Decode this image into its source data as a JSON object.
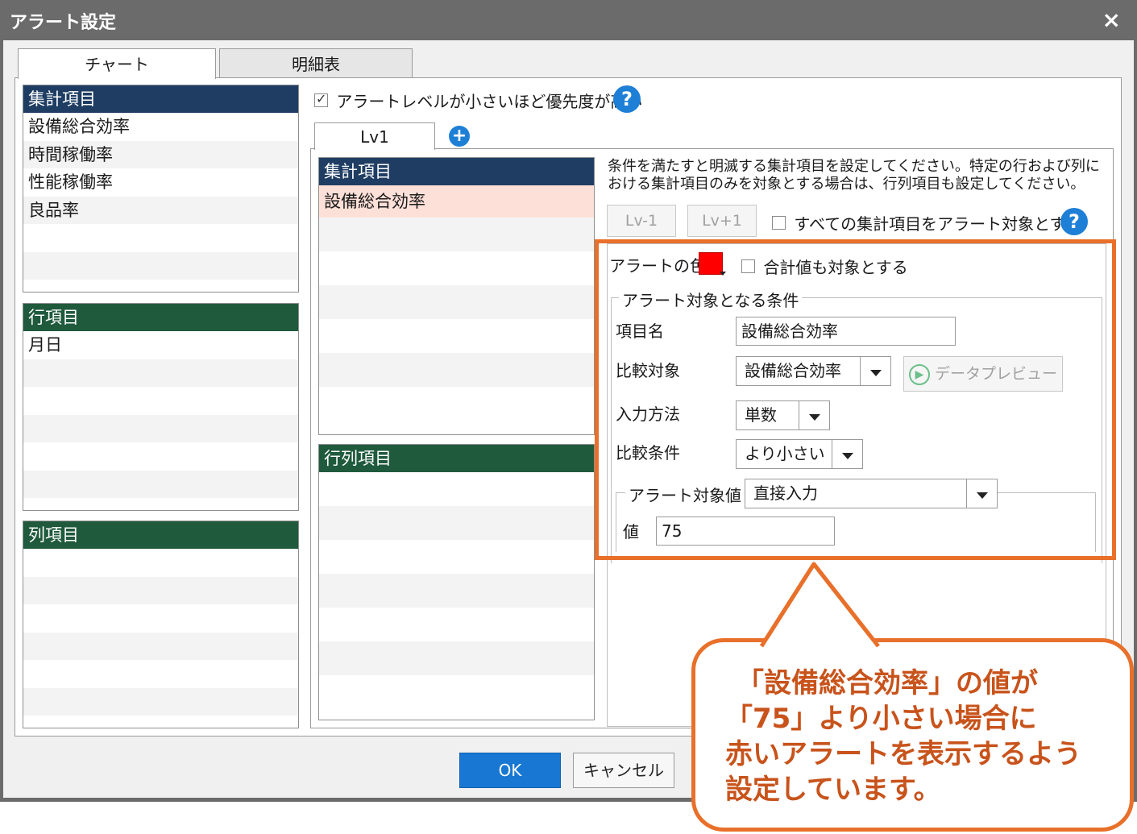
{
  "window": {
    "title": "アラート設定",
    "close": "×"
  },
  "tabs": [
    {
      "label": "チャート"
    },
    {
      "label": "明細表"
    }
  ],
  "left": {
    "aggregate": {
      "header": "集計項目",
      "items": [
        "設備総合効率",
        "時間稼働率",
        "性能稼働率",
        "良品率"
      ]
    },
    "rows": {
      "header": "行項目",
      "items": [
        "月日"
      ]
    },
    "columns": {
      "header": "列項目",
      "items": []
    }
  },
  "priority_check": {
    "label": "アラートレベルが小さいほど優先度が高い",
    "checked": true
  },
  "level_tab": {
    "label": "Lv1",
    "add": "+"
  },
  "center": {
    "aggregate_header": "集計項目",
    "selected_item": "設備総合効率",
    "matrix_header": "行列項目"
  },
  "description": {
    "line1": "条件を満たすと明滅する集計項目を設定してください。特定の行および列に",
    "line2": "おける集計項目のみを対象とする場合は、行列項目も設定してください。"
  },
  "level_buttons": {
    "minus": "Lv-1",
    "plus": "Lv+1"
  },
  "all_items_check": {
    "label": "すべての集計項目をアラート対象とする",
    "checked": false
  },
  "help_icon": "?",
  "alert": {
    "color_label": "アラートの色",
    "color": "#ff0000",
    "total_check": {
      "label": "合計値も対象とする",
      "checked": false
    },
    "condition_group": "アラート対象となる条件",
    "item_name_label": "項目名",
    "item_name_value": "設備総合効率",
    "compare_target_label": "比較対象",
    "compare_target_value": "設備総合効率",
    "preview_button": "データプレビュー",
    "input_method_label": "入力方法",
    "input_method_value": "単数",
    "compare_condition_label": "比較条件",
    "compare_condition_value": "より小さい",
    "target_value_group": "アラート対象値",
    "target_value_mode": "直接入力",
    "value_label": "値",
    "value": "75"
  },
  "footer": {
    "ok": "OK",
    "cancel": "キャンセル"
  },
  "callout": {
    "line1": "「設備総合効率」の値が",
    "line2": "「75」より小さい場合に",
    "line3": "赤いアラートを表示するよう",
    "line4": "設定しています。"
  },
  "colors": {
    "accent": "#e8702a",
    "header_blue": "#1f3d63",
    "header_green": "#1f5a3c",
    "ok": "#1877d2"
  }
}
